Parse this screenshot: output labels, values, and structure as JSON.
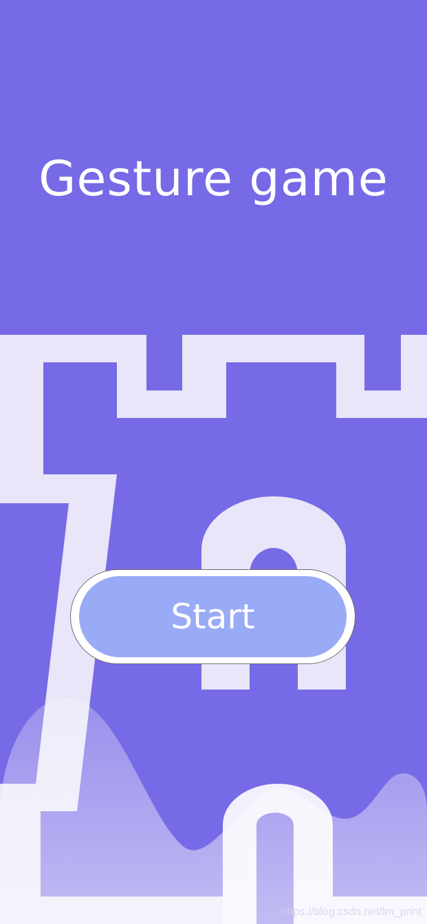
{
  "title": "Gesture game",
  "start_button": {
    "label": "Start"
  },
  "watermark": "https://blog.csdn.net/lm_print",
  "colors": {
    "background": "#776ae6",
    "castle": "#e8e6f8",
    "button_fill": "#99aaf6",
    "button_ring": "#ffffff",
    "text": "#ffffff"
  }
}
